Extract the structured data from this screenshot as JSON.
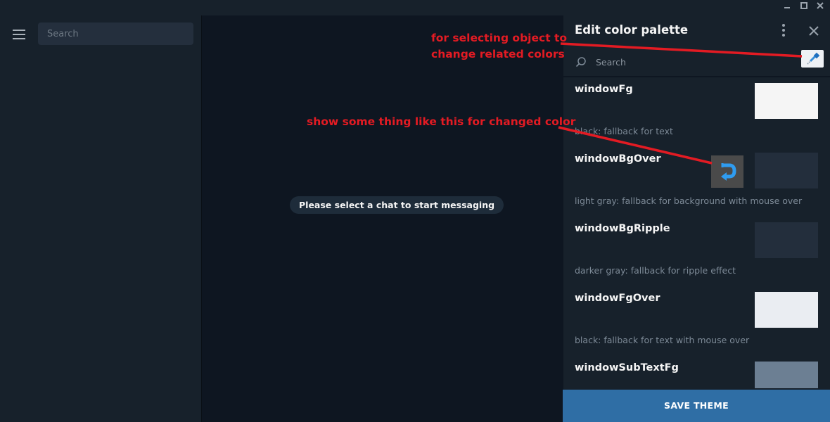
{
  "colors": {
    "window_bg": "#17212b",
    "chat_bg": "#0e1621",
    "accent": "#2f6ea5",
    "annotation": "#e31b23"
  },
  "titlebar": {
    "minimize_icon": "minimize-icon",
    "maximize_icon": "maximize-icon",
    "close_icon": "close-icon"
  },
  "sidebar": {
    "menu_icon": "hamburger-menu-icon",
    "search_placeholder": "Search"
  },
  "chat": {
    "empty_message": "Please select a chat to start messaging"
  },
  "palette_panel": {
    "title": "Edit color palette",
    "more_icon": "more-vertical-icon",
    "close_icon": "close-icon",
    "search_placeholder": "Search",
    "picker_icon": "eyedropper-icon",
    "items": [
      {
        "name": "windowFg",
        "description": "black: fallback for text",
        "swatch": "#f5f5f5"
      },
      {
        "name": "windowBgOver",
        "description": "light gray: fallback for background with mouse over",
        "swatch": "#232e3c"
      },
      {
        "name": "windowBgRipple",
        "description": "darker gray: fallback for ripple effect",
        "swatch": "#232e3c"
      },
      {
        "name": "windowFgOver",
        "description": "black: fallback for text with mouse over",
        "swatch": "#eaedf2"
      },
      {
        "name": "windowSubTextFg",
        "description": "",
        "swatch": "#6c7f93"
      }
    ],
    "changed_icon": "reset-arrow-icon",
    "save_label": "SAVE THEME"
  },
  "annotations": {
    "picker_note": "for selecting object to\nchange related colors",
    "changed_note": "show some thing like this for changed color"
  }
}
